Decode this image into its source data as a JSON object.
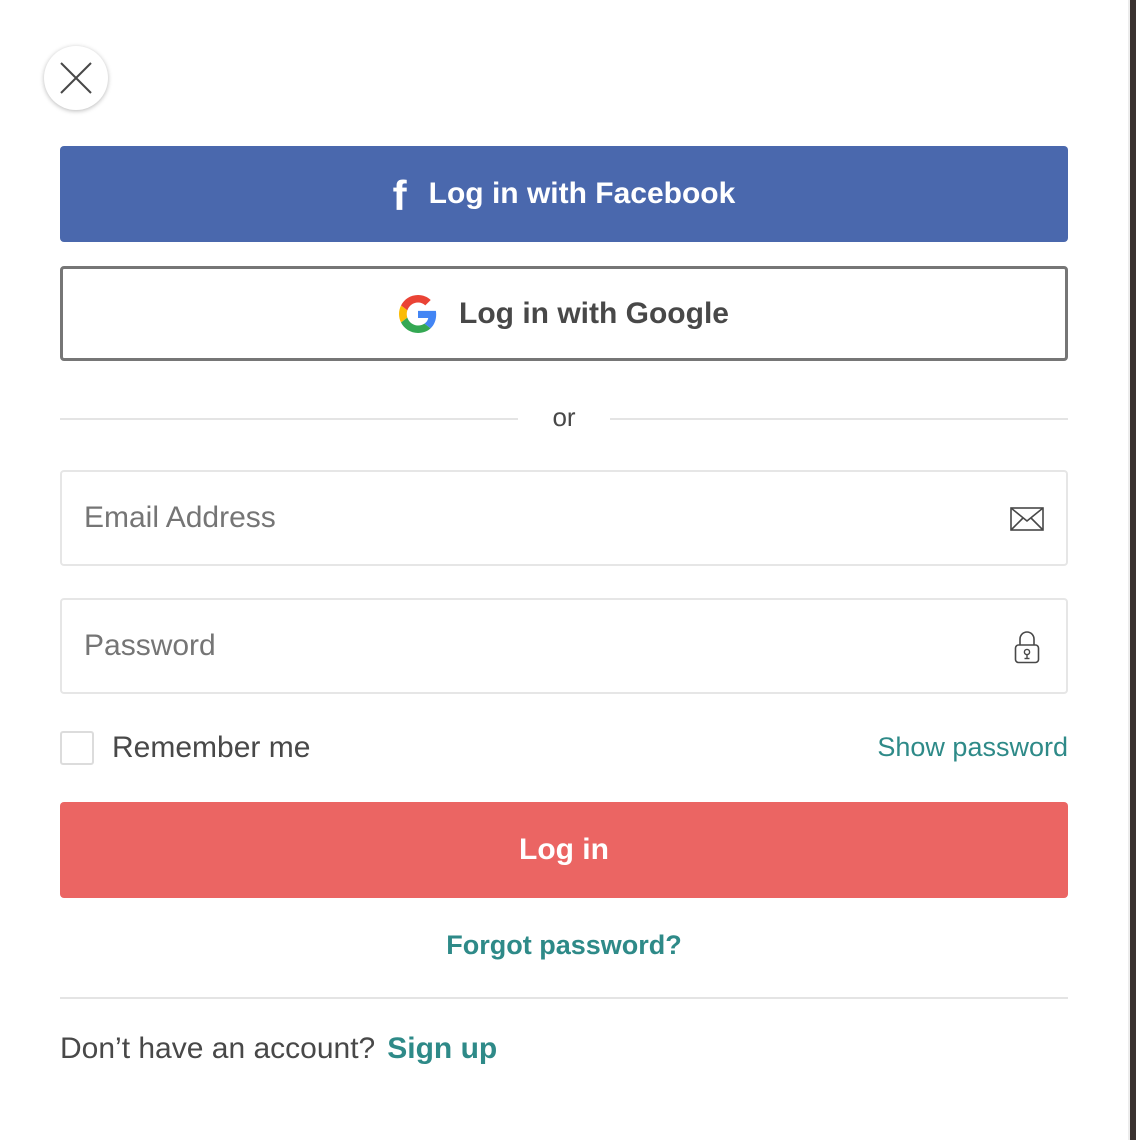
{
  "close": {
    "icon": "close-icon"
  },
  "facebook": {
    "label": "Log in with Facebook",
    "icon": "facebook-icon",
    "glyph": "f",
    "color": "#4a68ad"
  },
  "google": {
    "label": "Log in with Google",
    "icon": "google-icon"
  },
  "divider": {
    "text": "or"
  },
  "email": {
    "placeholder": "Email Address",
    "value": "",
    "icon": "envelope-icon"
  },
  "password": {
    "placeholder": "Password",
    "value": "",
    "icon": "lock-icon"
  },
  "remember": {
    "label": "Remember me",
    "checked": false
  },
  "show_password": {
    "label": "Show password"
  },
  "login": {
    "label": "Log in",
    "color": "#eb6563"
  },
  "forgot": {
    "label": "Forgot password?"
  },
  "signup": {
    "prompt": "Don’t have an account?",
    "link": "Sign up"
  },
  "colors": {
    "link": "#2e8a88",
    "text": "#484848"
  }
}
